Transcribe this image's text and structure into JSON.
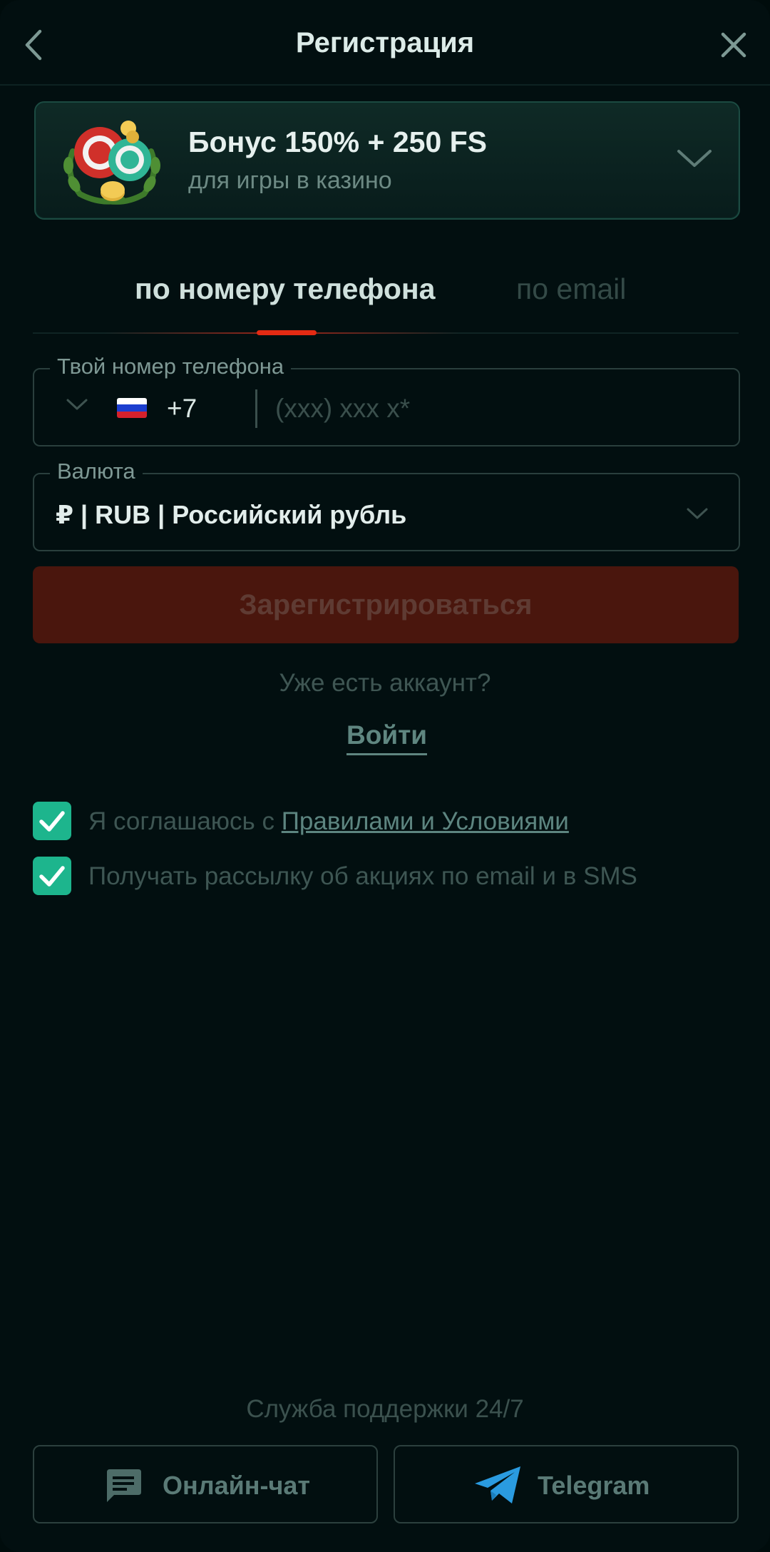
{
  "header": {
    "title": "Регистрация"
  },
  "bonus": {
    "title": "Бонус 150% + 250 FS",
    "subtitle": "для игры в казино"
  },
  "tabs": [
    {
      "label": "по номеру телефона",
      "active": true
    },
    {
      "label": "по email",
      "active": false
    }
  ],
  "phone": {
    "legend": "Твой номер телефона",
    "country_code": "+7",
    "placeholder": "(xxx) xxx x*",
    "value": ""
  },
  "currency": {
    "legend": "Валюта",
    "value": "₽ | RUB | Российский рубль"
  },
  "register_label": "Зарегистрироваться",
  "have_account": "Уже есть аккаунт?",
  "login_label": "Войти",
  "checkboxes": [
    {
      "text": "Я соглашаюсь с ",
      "link": "Правилами и Условиями",
      "checked": true
    },
    {
      "text": "Получать рассылку об акциях по email и в SMS",
      "checked": true
    }
  ],
  "support": {
    "title": "Служба поддержки 24/7",
    "chat_label": "Онлайн-чат",
    "telegram_label": "Telegram"
  },
  "colors": {
    "background": "#020f10",
    "accent_green": "#1db58d",
    "tab_underline": "#e42a13",
    "register_bg": "#4a160d",
    "telegram_blue": "#2a9be0"
  }
}
